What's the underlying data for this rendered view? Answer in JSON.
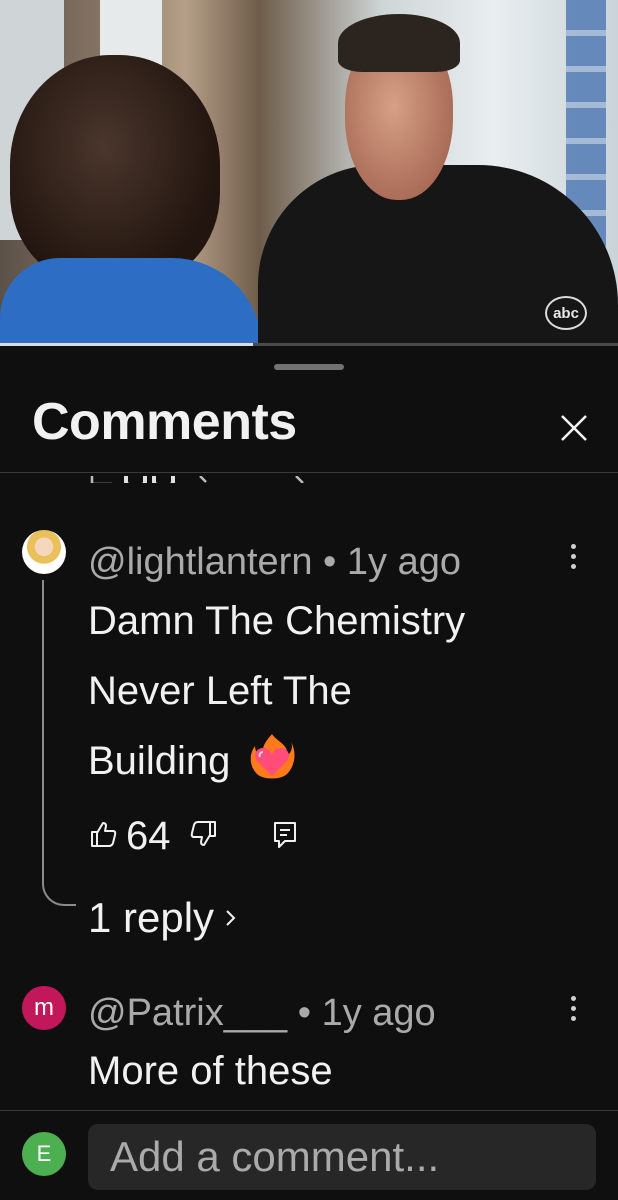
{
  "video": {
    "channel_logo": "abc",
    "progress_fraction": 0.41
  },
  "sheet": {
    "title": "Comments"
  },
  "comments": [
    {
      "handle": "@lightlantern",
      "separator": "•",
      "age": "1y ago",
      "text_lines": [
        "Damn The Chemistry",
        "Never Left The",
        "Building"
      ],
      "emoji": "❤️‍🔥",
      "likes": "64",
      "replies": "1 reply"
    },
    {
      "avatar_letter": "m",
      "handle": "@Patrix___",
      "separator": "•",
      "age": "1y ago",
      "text": "More of these"
    }
  ],
  "composer": {
    "avatar_letter": "E",
    "placeholder": "Add a comment..."
  },
  "icons": [
    "close-icon",
    "like-icon",
    "dislike-icon",
    "reply-icon",
    "more-vert-icon",
    "chevron-right-icon"
  ],
  "colors": {
    "background": "#0f0f0f",
    "text": "#f1f1f1",
    "muted": "#aaaaaa",
    "avatar_m": "#c2185b",
    "avatar_e": "#4caf50"
  }
}
